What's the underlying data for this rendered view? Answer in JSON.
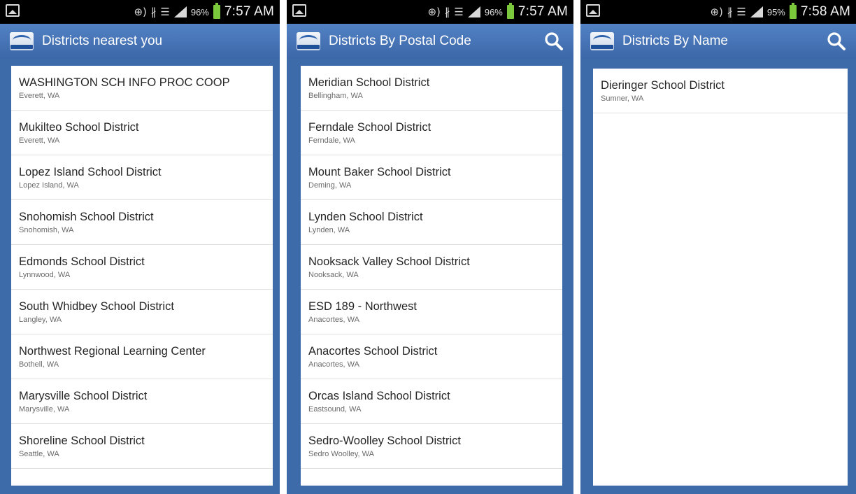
{
  "screens": [
    {
      "status": {
        "battery": "96%",
        "time": "7:57 AM"
      },
      "title": "Districts nearest you",
      "has_search": false,
      "items": [
        {
          "name": "WASHINGTON SCH INFO PROC COOP",
          "location": "Everett, WA"
        },
        {
          "name": "Mukilteo School District",
          "location": "Everett, WA"
        },
        {
          "name": "Lopez Island School District",
          "location": "Lopez Island, WA"
        },
        {
          "name": "Snohomish School District",
          "location": "Snohomish, WA"
        },
        {
          "name": "Edmonds School District",
          "location": "Lynnwood, WA"
        },
        {
          "name": "South Whidbey School District",
          "location": "Langley, WA"
        },
        {
          "name": "Northwest Regional Learning Center",
          "location": "Bothell, WA"
        },
        {
          "name": "Marysville School District",
          "location": "Marysville, WA"
        },
        {
          "name": "Shoreline School District",
          "location": "Seattle, WA"
        }
      ]
    },
    {
      "status": {
        "battery": "96%",
        "time": "7:57 AM"
      },
      "title": "Districts By Postal Code",
      "has_search": true,
      "items": [
        {
          "name": "Meridian School District",
          "location": "Bellingham, WA"
        },
        {
          "name": "Ferndale School District",
          "location": "Ferndale, WA"
        },
        {
          "name": "Mount Baker School District",
          "location": "Deming, WA"
        },
        {
          "name": "Lynden School District",
          "location": "Lynden, WA"
        },
        {
          "name": "Nooksack Valley School District",
          "location": "Nooksack, WA"
        },
        {
          "name": "ESD 189 - Northwest",
          "location": "Anacortes, WA"
        },
        {
          "name": "Anacortes School District",
          "location": "Anacortes, WA"
        },
        {
          "name": "Orcas Island School District",
          "location": "Eastsound, WA"
        },
        {
          "name": "Sedro-Woolley School District",
          "location": "Sedro Woolley, WA"
        }
      ]
    },
    {
      "status": {
        "battery": "95%",
        "time": "7:58 AM"
      },
      "title": "Districts By Name",
      "has_search": true,
      "items": [
        {
          "name": "Dieringer School District",
          "location": "Sumner, WA"
        }
      ]
    }
  ],
  "icons": {
    "gallery": "picture-notification-icon",
    "nfc": "nfc-icon",
    "bluetooth": "bluetooth-icon",
    "wifi": "wifi-icon",
    "signal": "signal-strength-icon",
    "battery": "battery-icon",
    "search": "search-icon"
  },
  "colors": {
    "background": "#3d6aa8",
    "action_bar": "#4a78bb",
    "status_bar": "#000000",
    "battery": "#7cc83c",
    "list_background": "#ffffff"
  }
}
